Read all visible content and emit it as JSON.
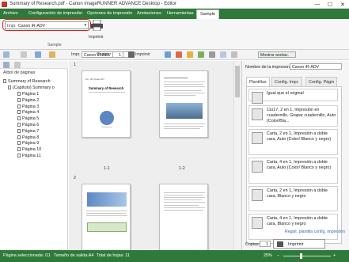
{
  "window": {
    "title": "Summary of Research.pdf - Canon imageRUNNER ADVANCE Desktop - Editor",
    "min": "—",
    "max": "☐",
    "close": "✕"
  },
  "menu": {
    "items": [
      "Archivo",
      "Configuración de impresión",
      "Opciones de impresión",
      "Anotaciones",
      "Herramientas",
      "Sample"
    ]
  },
  "ribbon": {
    "printer_label": "Impr.",
    "printer_value": "Canon iR-ADV",
    "print_label": "Imprimir",
    "group_label": "Sample"
  },
  "toolbar": {
    "printer_label": "Impr.",
    "printer_value": "Canon iR-ADV",
    "copies_label": "Copias:",
    "copies_value": "1",
    "print_label": "Imprimir",
    "show_annotations": "Mostrar anotac."
  },
  "tree": {
    "title": "Árbol de páginas",
    "root": "Summary of Research",
    "chapter": "(Capítulo) Summary o",
    "pages": [
      "Página 1",
      "Página 2",
      "Página 3",
      "Página 4",
      "Página 5",
      "Página 6",
      "Página 7",
      "Página 8",
      "Página 9",
      "Página 10",
      "Página 11"
    ]
  },
  "pages": {
    "group1": "1",
    "group2": "2",
    "thumb1": "1-1",
    "thumb2": "1-2",
    "p1_title": "Summary of Research"
  },
  "right": {
    "printer_name_label": "Nombre de la impresora:",
    "printer_name_value": "Canon iR-ADV",
    "tabs": [
      "Plantillas",
      "Config. Impr.",
      "Config. Págin"
    ],
    "templates": [
      "Igual que el original",
      "11x17, 2 en 1, Impresión en cuadernillo, Grapar cuadernillo, Auto (Color/Bla...",
      "Carta, 2 en 1, Impresión a doble cara, Auto (Color/ Blanco y negro)",
      "Carta, 4 en 1, Impresión a doble cara, Auto (Color/ Blanco y negro)",
      "Carta, 2 en 1, Impresión a doble cara, Blanco y negro",
      "Carta, 4 en 1, Impresión a doble cara, Blanco y negro"
    ],
    "register_link": "Regist. plantilla config. impresión",
    "copies_label": "Copias:",
    "copies_value": "1",
    "print_button": "Imprimir"
  },
  "status": {
    "selected": "Página seleccionada: /11",
    "size": "Tamaño de salida:A4",
    "total": "Total de hojas: 11",
    "zoom": "25%"
  },
  "colors": {
    "accent": "#2f7a3b",
    "highlight": "#d9231d"
  }
}
